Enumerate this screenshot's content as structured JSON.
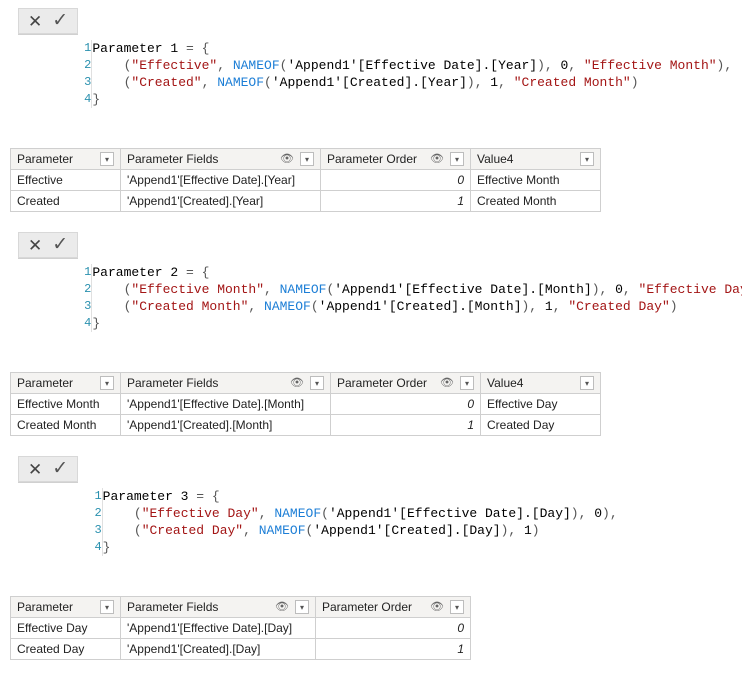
{
  "blocks": [
    {
      "code": {
        "l1": {
          "name": "Parameter 1"
        },
        "l2": {
          "s1": "\"Effective\"",
          "fn": "NAMEOF",
          "ref": "'Append1'[Effective Date].[Year]",
          "num": "0",
          "s2": "\"Effective Month\""
        },
        "l3": {
          "s1": "\"Created\"",
          "fn": "NAMEOF",
          "ref": "'Append1'[Created].[Year]",
          "num": "1",
          "s2": "\"Created Month\""
        }
      },
      "headers": {
        "c1": "Parameter",
        "c2": "Parameter Fields",
        "c3": "Parameter Order",
        "c4": "Value4"
      },
      "rows": [
        {
          "c1": "Effective",
          "c2": "'Append1'[Effective Date].[Year]",
          "c3": "0",
          "c4": "Effective Month"
        },
        {
          "c1": "Created",
          "c2": "'Append1'[Created].[Year]",
          "c3": "1",
          "c4": "Created Month"
        }
      ]
    },
    {
      "code": {
        "l1": {
          "name": "Parameter 2"
        },
        "l2": {
          "s1": "\"Effective Month\"",
          "fn": "NAMEOF",
          "ref": "'Append1'[Effective Date].[Month]",
          "num": "0",
          "s2": "\"Effective Day\""
        },
        "l3": {
          "s1": "\"Created Month\"",
          "fn": "NAMEOF",
          "ref": "'Append1'[Created].[Month]",
          "num": "1",
          "s2": "\"Created Day\""
        }
      },
      "headers": {
        "c1": "Parameter",
        "c2": "Parameter Fields",
        "c3": "Parameter Order",
        "c4": "Value4"
      },
      "rows": [
        {
          "c1": "Effective Month",
          "c2": "'Append1'[Effective Date].[Month]",
          "c3": "0",
          "c4": "Effective Day"
        },
        {
          "c1": "Created Month",
          "c2": "'Append1'[Created].[Month]",
          "c3": "1",
          "c4": "Created Day"
        }
      ]
    },
    {
      "code": {
        "l1": {
          "name": "Parameter 3"
        },
        "l2": {
          "s1": "\"Effective Day\"",
          "fn": "NAMEOF",
          "ref": "'Append1'[Effective Date].[Day]",
          "num": "0"
        },
        "l3": {
          "s1": "\"Created Day\"",
          "fn": "NAMEOF",
          "ref": "'Append1'[Created].[Day]",
          "num": "1"
        }
      },
      "headers": {
        "c1": "Parameter",
        "c2": "Parameter Fields",
        "c3": "Parameter Order"
      },
      "rows": [
        {
          "c1": "Effective Day",
          "c2": "'Append1'[Effective Date].[Day]",
          "c3": "0"
        },
        {
          "c1": "Created Day",
          "c2": "'Append1'[Created].[Day]",
          "c3": "1"
        }
      ]
    }
  ],
  "chart_data": [
    {
      "type": "table",
      "title": "Parameter 1",
      "columns": [
        "Parameter",
        "Parameter Fields",
        "Parameter Order",
        "Value4"
      ],
      "rows": [
        [
          "Effective",
          "'Append1'[Effective Date].[Year]",
          0,
          "Effective Month"
        ],
        [
          "Created",
          "'Append1'[Created].[Year]",
          1,
          "Created Month"
        ]
      ]
    },
    {
      "type": "table",
      "title": "Parameter 2",
      "columns": [
        "Parameter",
        "Parameter Fields",
        "Parameter Order",
        "Value4"
      ],
      "rows": [
        [
          "Effective Month",
          "'Append1'[Effective Date].[Month]",
          0,
          "Effective Day"
        ],
        [
          "Created Month",
          "'Append1'[Created].[Month]",
          1,
          "Created Day"
        ]
      ]
    },
    {
      "type": "table",
      "title": "Parameter 3",
      "columns": [
        "Parameter",
        "Parameter Fields",
        "Parameter Order"
      ],
      "rows": [
        [
          "Effective Day",
          "'Append1'[Effective Date].[Day]",
          0
        ],
        [
          "Created Day",
          "'Append1'[Created].[Day]",
          1
        ]
      ]
    }
  ]
}
